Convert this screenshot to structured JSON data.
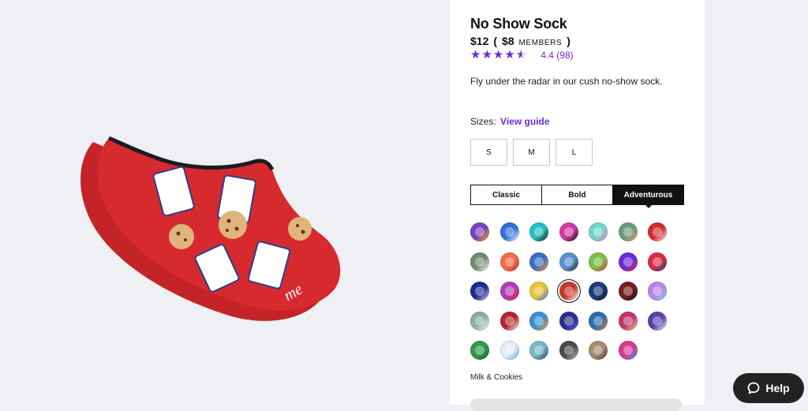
{
  "product": {
    "title": "No Show Sock",
    "price": "$12",
    "member_price": "$8",
    "members_label": "MEMBERS",
    "paren_open": "(",
    "paren_close": ")",
    "rating_value": 4.4,
    "rating_text": "4.4 (98)",
    "description": "Fly under the radar in our cush no-show sock."
  },
  "sizes": {
    "label": "Sizes:",
    "guide_link": "View guide",
    "options": [
      "S",
      "M",
      "L"
    ]
  },
  "style_tabs": {
    "options": [
      "Classic",
      "Bold",
      "Adventurous"
    ],
    "active": "Adventurous"
  },
  "swatches": [
    {
      "color": "#7a3fc2",
      "accent": "#f5b700"
    },
    {
      "color": "#2f6fd6",
      "accent": "#ffffff"
    },
    {
      "color": "#23c0c5",
      "accent": "#222222"
    },
    {
      "color": "#d43aa7",
      "accent": "#111111"
    },
    {
      "color": "#6fd5cf",
      "accent": "#f07cc5"
    },
    {
      "color": "#6c9b7a",
      "accent": "#e89a6d"
    },
    {
      "color": "#d32b2b",
      "accent": "#ffffff"
    },
    {
      "color": "#6f8f6a",
      "accent": "#ffffff"
    },
    {
      "color": "#f06d4a",
      "accent": "#c23a2a"
    },
    {
      "color": "#3b6ec9",
      "accent": "#f0a030"
    },
    {
      "color": "#5a8fd1",
      "accent": "#333333"
    },
    {
      "color": "#7cc04a",
      "accent": "#e03a3a"
    },
    {
      "color": "#6a2bd9",
      "accent": "#e32b4a"
    },
    {
      "color": "#d62e3f",
      "accent": "#2a3f8f"
    },
    {
      "color": "#1e2a8f",
      "accent": "#f0c8f0"
    },
    {
      "color": "#b43ab8",
      "accent": "#e02a2a"
    },
    {
      "color": "#e9c53a",
      "accent": "#3a7fd0"
    },
    {
      "color": "#c4352b",
      "accent": "#ffffff"
    },
    {
      "color": "#1f3b7a",
      "accent": "#0d1e4a"
    },
    {
      "color": "#7a1f1f",
      "accent": "#111111"
    },
    {
      "color": "#b886e8",
      "accent": "#7fd0e0"
    },
    {
      "color": "#8fae9a",
      "accent": "#ffffff"
    },
    {
      "color": "#b5242f",
      "accent": "#ffffff"
    },
    {
      "color": "#3a8fd6",
      "accent": "#f0a030"
    },
    {
      "color": "#2b2f8f",
      "accent": "#5a63d8"
    },
    {
      "color": "#2a6fb5",
      "accent": "#f07a2a"
    },
    {
      "color": "#c2346e",
      "accent": "#f4d08a"
    },
    {
      "color": "#5d3fa8",
      "accent": "#ffffff"
    },
    {
      "color": "#2f9b4a",
      "accent": "#1f6a2f"
    },
    {
      "color": "#e6eef7",
      "accent": "#7aa7d0"
    },
    {
      "color": "#7ab7c7",
      "accent": "#2a4a6a"
    },
    {
      "color": "#4a4a4a",
      "accent": "#bfbfbf"
    },
    {
      "color": "#a78c74",
      "accent": "#5c4030"
    },
    {
      "color": "#d63a8f",
      "accent": "#3aa0e0"
    }
  ],
  "selected_swatch_index": 17,
  "selected_name": "Milk & Cookies",
  "help": {
    "label": "Help",
    "icon": "chat-bubble-icon"
  },
  "colors": {
    "accent": "#6a2bd9",
    "sock_red": "#d72a2f",
    "help_bg": "#222222"
  }
}
